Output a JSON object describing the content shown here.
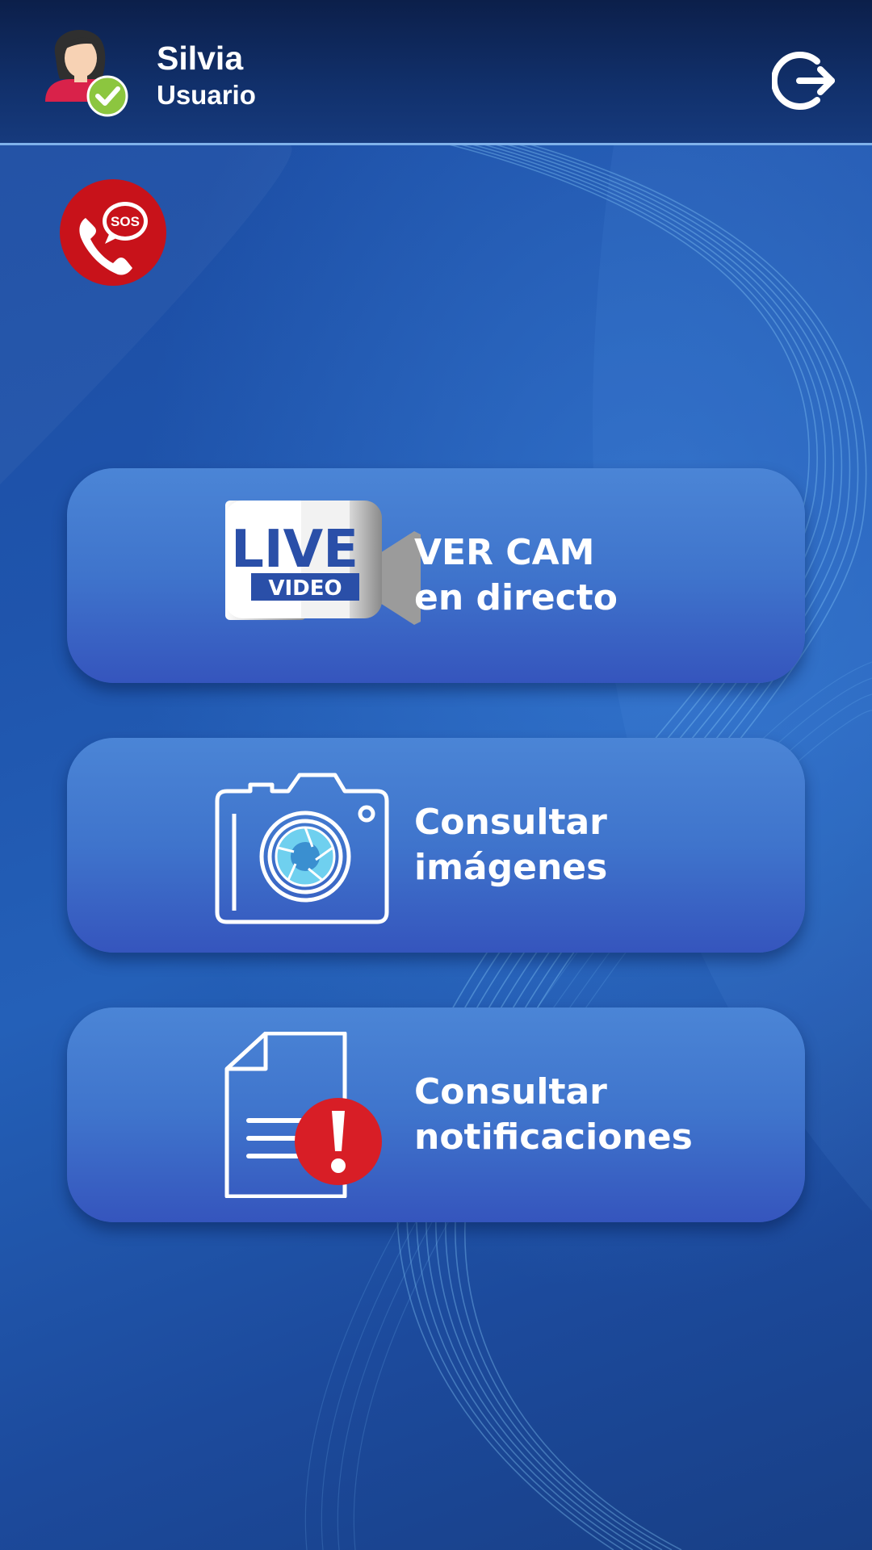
{
  "header": {
    "user_name": "Silvia",
    "user_role": "Usuario",
    "avatar_icon": "user-avatar-verified-icon",
    "logout_icon": "logout-icon"
  },
  "sos": {
    "label": "SOS",
    "icon": "sos-phone-icon",
    "color": "#c8121a"
  },
  "menu": {
    "items": [
      {
        "icon": "live-video-camera-icon",
        "icon_text_top": "LIVE",
        "icon_text_bottom": "VIDEO",
        "line1": "VER CAM",
        "line2": "en directo"
      },
      {
        "icon": "camera-icon",
        "line1": "Consultar",
        "line2": "imágenes"
      },
      {
        "icon": "document-alert-icon",
        "line1": "Consultar",
        "line2": "notificaciones"
      }
    ]
  },
  "colors": {
    "background": "#1e4ea3",
    "header": "#11306b",
    "card": "#4279cf",
    "alert_red": "#d81e26",
    "verified_green": "#8cc63f",
    "lens_cyan": "#6fd0ef"
  }
}
